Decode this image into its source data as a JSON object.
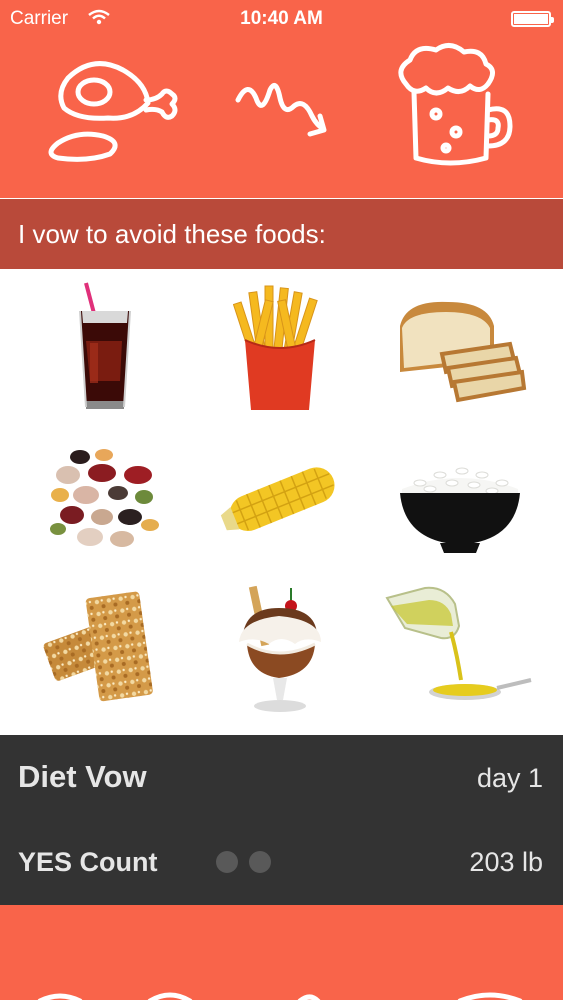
{
  "status_bar": {
    "carrier": "Carrier",
    "time": "10:40 AM"
  },
  "header": {
    "icons": [
      "ham-icon",
      "squiggle-arrow-icon",
      "beer-mug-icon"
    ]
  },
  "vow": {
    "text": "I vow to avoid these foods:"
  },
  "foods": [
    {
      "name": "soda",
      "icon": "soda-glass-icon"
    },
    {
      "name": "fries",
      "icon": "french-fries-icon"
    },
    {
      "name": "bread",
      "icon": "bread-loaf-icon"
    },
    {
      "name": "beans",
      "icon": "beans-icon"
    },
    {
      "name": "corn",
      "icon": "corn-cob-icon"
    },
    {
      "name": "rice",
      "icon": "rice-bowl-icon"
    },
    {
      "name": "granola bars",
      "icon": "granola-bar-icon"
    },
    {
      "name": "sundae",
      "icon": "ice-cream-sundae-icon"
    },
    {
      "name": "oil",
      "icon": "olive-oil-icon"
    }
  ],
  "stats": {
    "title": "Diet Vow",
    "day_label": "day 1",
    "yes_label": "YES Count",
    "weight": "203  lb"
  },
  "colors": {
    "accent": "#f9644a",
    "vow_bar": "#b94a3a",
    "stats_bg": "#333333"
  }
}
